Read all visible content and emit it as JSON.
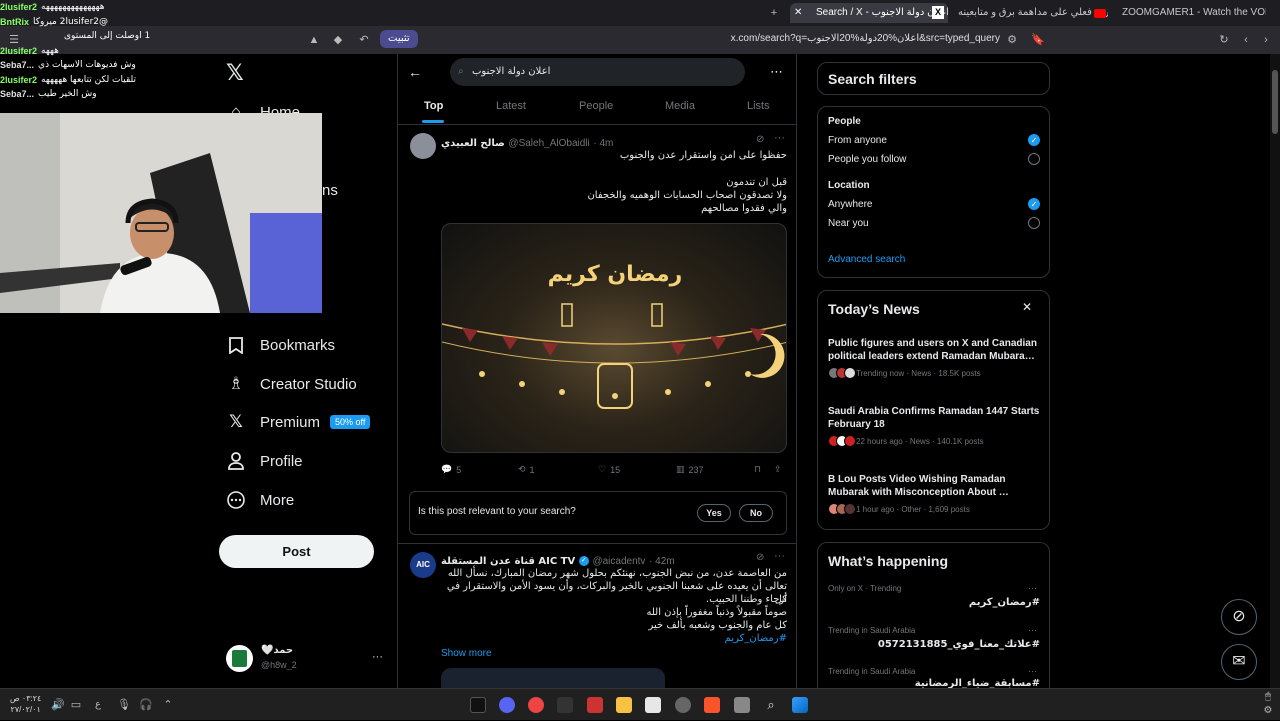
{
  "browser": {
    "tabs": [
      {
        "title": "Search / X - اعلان دولة الاجنوب"
      },
      {
        "title": "ردة فعلي على مداهمة برق و متابعينه"
      },
      {
        "title": "ZOOMGAMER1 - Watch the VOD on"
      }
    ],
    "new_tab_symbol": "+",
    "url": "x.com/search?q=اعلان%20دولة%20الاجنوب&src=typed_query",
    "install_label": "تثبيت"
  },
  "chat": [
    {
      "user": "2lusifer2",
      "msg": "ههههههههههههههه"
    },
    {
      "user": "BntRix",
      "msg": "@2lusifer2 ميروكا"
    },
    {
      "user": "",
      "msg": "1 اوصلت إلى المستوى"
    },
    {
      "user": "2lusifer2",
      "msg": "هههه"
    },
    {
      "user": "Seba7...",
      "msg": "وش فديوهات الاسهات ذي"
    },
    {
      "user": "2lusifer2",
      "msg": "تلقيات لكن تتابعها هههههه"
    },
    {
      "user": "Seba7...",
      "msg": "وش الخير طيب"
    }
  ],
  "nav": {
    "home": "Home",
    "partial": "ns",
    "bookmarks": "Bookmarks",
    "creator_studio": "Creator Studio",
    "premium": "Premium",
    "premium_badge": "50% off",
    "profile": "Profile",
    "more": "More",
    "post": "Post",
    "account_name": "حمد🤍",
    "account_handle": "@h8w_2"
  },
  "search": {
    "query": "اعلان دولة الاجنوب",
    "tabs": [
      "Top",
      "Latest",
      "People",
      "Media",
      "Lists"
    ]
  },
  "tweet1": {
    "name": "صالح العبيدي",
    "handle": "@Saleh_AlObaidli",
    "time": "· 4m",
    "line1": "حفظوا على امن واستقرار عدن والجنوب",
    "line2": "قبل ان تندمون",
    "line3": "ولا تصدقون اصحاب الحسابات الوهميه والخجفان",
    "line4": "والي فقدوا مصالحهم",
    "image_text": "رمضان كريم",
    "replies": "5",
    "reposts": "1",
    "likes": "15",
    "views": "237"
  },
  "relevance": {
    "question": "Is this post relevant to your search?",
    "yes": "Yes",
    "no": "No"
  },
  "tweet2": {
    "name": "قناة عدن المستقلة AIC TV",
    "handle": "@aicadentv",
    "time": "· 42m",
    "avatar_text": "AIC",
    "line1": "من العاصمة عدن، من نبض الجنوب، نهنئكم بحلول شهر رمضان المبارك، نسأل الله",
    "line2": "تعالى أن يعيده على شعبنا الجنوبي بالخير والبركات، وأن يسود الأمن والاستقرار في كل",
    "line3": "أرجاء وطننا الحبيب.",
    "line4": "صوماً مقبولاً وذنباً مغفوراً بإذن الله",
    "line5": "كل عام والجنوب وشعبه بألف خير",
    "hashtag": "#رمضان_كريم",
    "show_more": "Show more"
  },
  "filters": {
    "title": "Search filters",
    "people_label": "People",
    "from_anyone": "From anyone",
    "people_you_follow": "People you follow",
    "location_label": "Location",
    "anywhere": "Anywhere",
    "near_you": "Near you",
    "advanced": "Advanced search"
  },
  "news": {
    "title": "Today’s News",
    "items": [
      {
        "title": "Public figures and users on X and Canadian political leaders extend Ramadan Mubara…",
        "meta": "Trending now · News · 18.5K posts"
      },
      {
        "title": "Saudi Arabia Confirms Ramadan 1447 Starts February 18",
        "meta": "22 hours ago · News · 140.1K posts"
      },
      {
        "title": "B Lou Posts Video Wishing Ramadan Mubarak with Misconception About …",
        "meta": "1 hour ago · Other · 1,609 posts"
      }
    ]
  },
  "happening": {
    "title": "What’s happening",
    "items": [
      {
        "context": "Only on X · Trending",
        "name": "#رمضان_كريم"
      },
      {
        "context": "Trending in Saudi Arabia",
        "name": "#علاتك_معنا_فوي_0572131885"
      },
      {
        "context": "Trending in Saudi Arabia",
        "name": "#مسابقة_ضياء_الرمضانية"
      }
    ]
  },
  "taskbar": {
    "time": "٠٣:٢٤ ص",
    "date": "٢٧/٠٢/٠١",
    "lang": "ع"
  },
  "colors": {
    "accent": "#1d9bf0",
    "bg": "#000000",
    "border": "#2f3336"
  }
}
